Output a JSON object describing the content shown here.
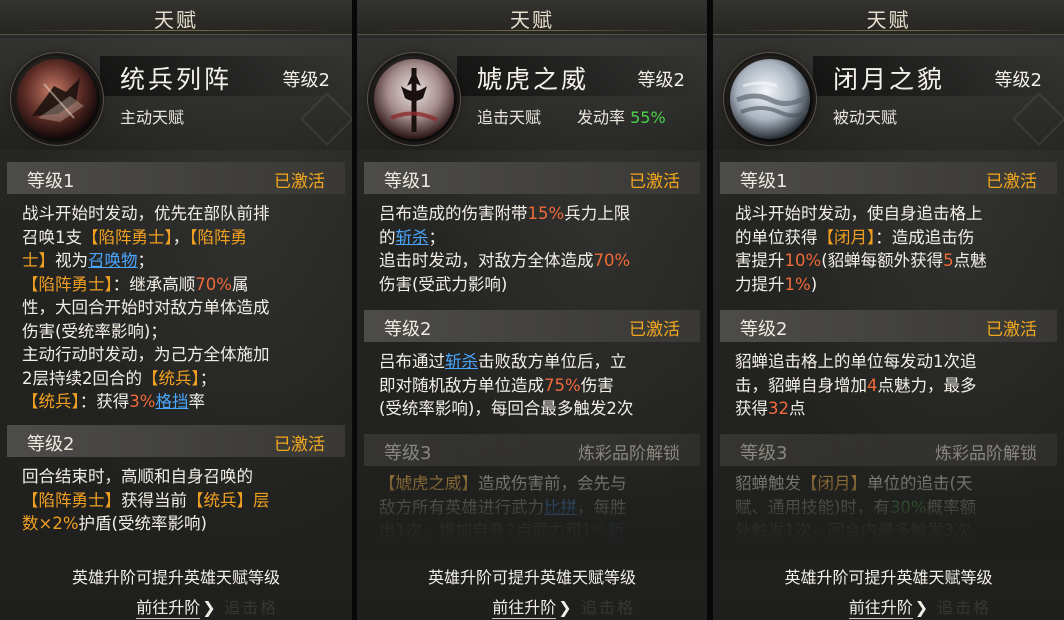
{
  "panels": [
    {
      "title": "天赋",
      "talent_name": "统兵列阵",
      "level": "等级2",
      "type": "主动天赋",
      "icon": "formation-banner-icon",
      "sections": [
        {
          "header": "等级1",
          "status": "已激活",
          "locked": false,
          "lines": [
            [
              {
                "t": "战斗开始时发动，优先在部队前排"
              }
            ],
            [
              {
                "t": "召唤1支"
              },
              {
                "t": "【陷阵勇士】",
                "c": "o"
              },
              {
                "t": "，"
              },
              {
                "t": "【陷阵勇",
                "c": "o"
              }
            ],
            [
              {
                "t": "士】",
                "c": "o"
              },
              {
                "t": "视为"
              },
              {
                "t": "召唤物",
                "c": "b"
              },
              {
                "t": "；"
              }
            ],
            [
              {
                "t": "【陷阵勇士】",
                "c": "o"
              },
              {
                "t": "：继承高顺"
              },
              {
                "t": "70%",
                "c": "r"
              },
              {
                "t": "属"
              }
            ],
            [
              {
                "t": "性，大回合开始时对敌方单体造成"
              }
            ],
            [
              {
                "t": "伤害(受统率影响)；"
              }
            ],
            [
              {
                "t": "主动行动时发动，为己方全体施加"
              }
            ],
            [
              {
                "t": "2层持续2回合的"
              },
              {
                "t": "【统兵】",
                "c": "o"
              },
              {
                "t": "；"
              }
            ],
            [
              {
                "t": "【统兵】",
                "c": "o"
              },
              {
                "t": "：获得"
              },
              {
                "t": "3%",
                "c": "r"
              },
              {
                "t": "格挡",
                "c": "b"
              },
              {
                "t": "率"
              }
            ]
          ]
        },
        {
          "header": "等级2",
          "status": "已激活",
          "locked": false,
          "lines": [
            [
              {
                "t": "回合结束时，高顺和自身召唤的"
              }
            ],
            [
              {
                "t": "【陷阵勇士】",
                "c": "o"
              },
              {
                "t": "获得当前"
              },
              {
                "t": "【统兵】",
                "c": "o"
              },
              {
                "t": "层",
                "c": "o"
              }
            ],
            [
              {
                "t": "数×2%",
                "c": "o"
              },
              {
                "t": "护盾(受统率影响)"
              }
            ]
          ]
        }
      ],
      "footer_note": "英雄升阶可提升英雄天赋等级",
      "goto_label": "前往升阶",
      "ghost_label": "追击格"
    },
    {
      "title": "天赋",
      "talent_name": "虓虎之威",
      "level": "等级2",
      "type": "追击天赋",
      "rate_label": "发动率",
      "rate_value": "55%",
      "icon": "halberd-icon",
      "sections": [
        {
          "header": "等级1",
          "status": "已激活",
          "locked": false,
          "lines": [
            [
              {
                "t": "吕布造成的伤害附带"
              },
              {
                "t": "15%",
                "c": "r"
              },
              {
                "t": "兵力上限"
              }
            ],
            [
              {
                "t": "的"
              },
              {
                "t": "斩杀",
                "c": "b"
              },
              {
                "t": "；"
              }
            ],
            [
              {
                "t": "追击时发动，对敌方全体造成"
              },
              {
                "t": "70%",
                "c": "r"
              }
            ],
            [
              {
                "t": "伤害(受武力影响)"
              }
            ]
          ]
        },
        {
          "header": "等级2",
          "status": "已激活",
          "locked": false,
          "lines": [
            [
              {
                "t": "吕布通过"
              },
              {
                "t": "斩杀",
                "c": "b"
              },
              {
                "t": "击败敌方单位后，立"
              }
            ],
            [
              {
                "t": "即对随机敌方单位造成"
              },
              {
                "t": "75%",
                "c": "r"
              },
              {
                "t": "伤害"
              }
            ],
            [
              {
                "t": "(受统率影响)，每回合最多触发2次"
              }
            ]
          ]
        },
        {
          "header": "等级3",
          "status": "炼彩品阶解锁",
          "locked": true,
          "lines": [
            [
              {
                "t": "【虓虎之威】",
                "c": "o"
              },
              {
                "t": "造成伤害前，会先与"
              }
            ],
            [
              {
                "t": "敌方所有英雄进行武力"
              },
              {
                "t": "比拼",
                "c": "b"
              },
              {
                "t": "，每胜"
              }
            ],
            [
              {
                "t": "出1次，增加自身"
              },
              {
                "t": "2",
                "c": "r"
              },
              {
                "t": "点武力和"
              },
              {
                "t": "1%",
                "c": "r"
              },
              {
                "t": "斩",
                "c": "b"
              }
            ]
          ]
        }
      ],
      "footer_note": "英雄升阶可提升英雄天赋等级",
      "goto_label": "前往升阶",
      "ghost_label": "追击格"
    },
    {
      "title": "天赋",
      "talent_name": "闭月之貌",
      "level": "等级2",
      "type": "被动天赋",
      "icon": "moon-icon",
      "sections": [
        {
          "header": "等级1",
          "status": "已激活",
          "locked": false,
          "lines": [
            [
              {
                "t": "战斗开始时发动，使自身追击格上"
              }
            ],
            [
              {
                "t": "的单位获得"
              },
              {
                "t": "【闭月】",
                "c": "o"
              },
              {
                "t": "：造成追击伤"
              }
            ],
            [
              {
                "t": "害提升"
              },
              {
                "t": "10%",
                "c": "r"
              },
              {
                "t": "(貂蝉每额外获得"
              },
              {
                "t": "5",
                "c": "r"
              },
              {
                "t": "点魅"
              }
            ],
            [
              {
                "t": "力提升"
              },
              {
                "t": "1%",
                "c": "r"
              },
              {
                "t": ")"
              }
            ]
          ]
        },
        {
          "header": "等级2",
          "status": "已激活",
          "locked": false,
          "lines": [
            [
              {
                "t": "貂蝉追击格上的单位每发动1次追"
              }
            ],
            [
              {
                "t": "击，貂蝉自身增加"
              },
              {
                "t": "4",
                "c": "r"
              },
              {
                "t": "点魅力，最多"
              }
            ],
            [
              {
                "t": "获得"
              },
              {
                "t": "32",
                "c": "r"
              },
              {
                "t": "点"
              }
            ]
          ]
        },
        {
          "header": "等级3",
          "status": "炼彩品阶解锁",
          "locked": true,
          "lines": [
            [
              {
                "t": "貂蝉触发"
              },
              {
                "t": "【闭月】",
                "c": "o"
              },
              {
                "t": "单位的追击(天"
              }
            ],
            [
              {
                "t": "赋、通用技能)时，有"
              },
              {
                "t": "30%",
                "c": "g"
              },
              {
                "t": "概率额"
              }
            ],
            [
              {
                "t": "外触发1次，回合内最多触发3次"
              }
            ]
          ]
        }
      ],
      "footer_note": "英雄升阶可提升英雄天赋等级",
      "goto_label": "前往升阶",
      "ghost_label": "追击格"
    }
  ],
  "colors": {
    "accent_orange": "#f0a020",
    "value_red": "#f06a3a",
    "keyword_blue": "#4aa6ff",
    "rate_green": "#4bd14b",
    "status_active": "#f4a81d"
  }
}
